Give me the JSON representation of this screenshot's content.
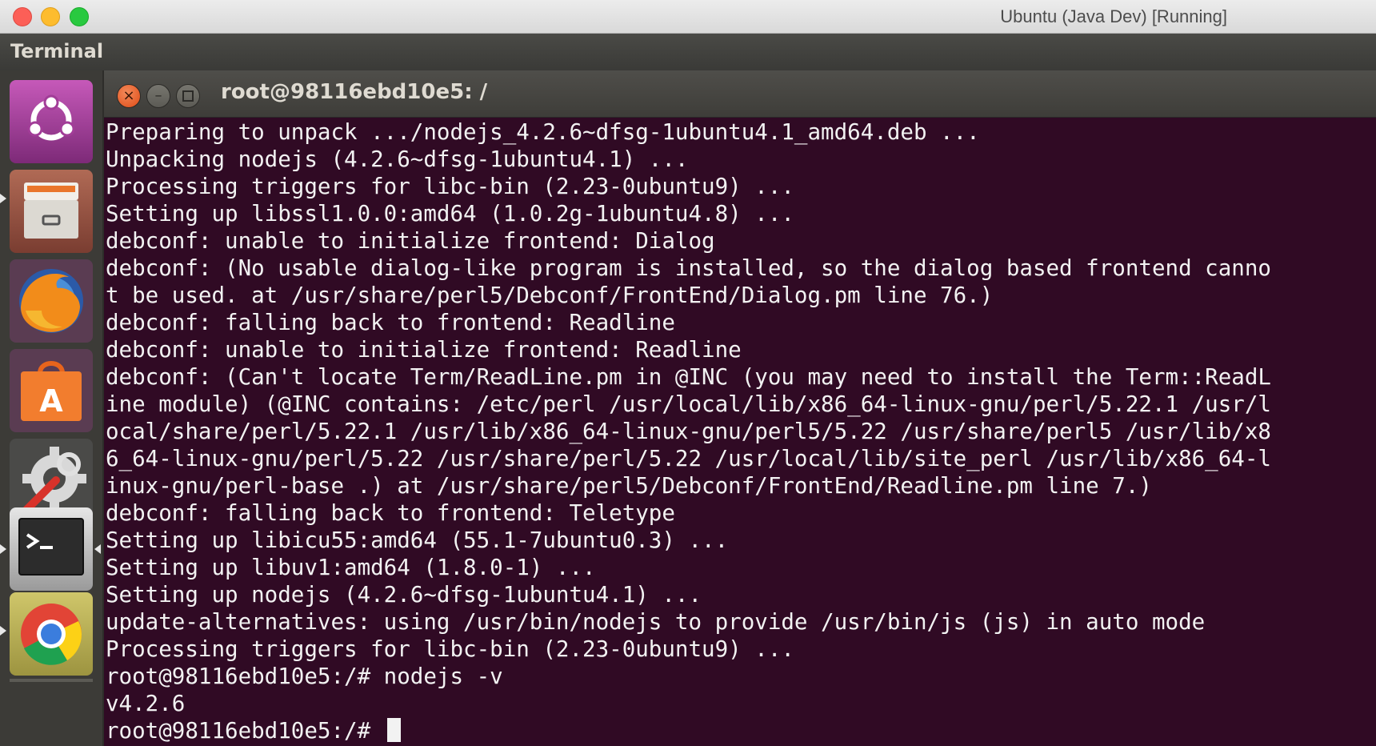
{
  "host_window": {
    "title": "Ubuntu (Java Dev) [Running]"
  },
  "panel": {
    "app_title": "Terminal"
  },
  "launcher": {
    "items": [
      {
        "name": "ubuntu-dash",
        "icon": "ubuntu-logo-icon"
      },
      {
        "name": "files",
        "icon": "file-cabinet-icon"
      },
      {
        "name": "firefox",
        "icon": "firefox-icon"
      },
      {
        "name": "software-center",
        "icon": "shopping-bag-icon"
      },
      {
        "name": "system-settings",
        "icon": "wrench-gear-icon"
      },
      {
        "name": "terminal",
        "icon": "terminal-icon"
      },
      {
        "name": "chrome",
        "icon": "chrome-icon"
      }
    ]
  },
  "terminal": {
    "title": "root@98116ebd10e5: /",
    "prompt": "root@98116ebd10e5:/# ",
    "colors": {
      "background": "#300a24",
      "foreground": "#f2f2f2",
      "close_button": "#df4b16"
    },
    "lines": [
      "Preparing to unpack .../nodejs_4.2.6~dfsg-1ubuntu4.1_amd64.deb ...",
      "Unpacking nodejs (4.2.6~dfsg-1ubuntu4.1) ...",
      "Processing triggers for libc-bin (2.23-0ubuntu9) ...",
      "Setting up libssl1.0.0:amd64 (1.0.2g-1ubuntu4.8) ...",
      "debconf: unable to initialize frontend: Dialog",
      "debconf: (No usable dialog-like program is installed, so the dialog based frontend canno",
      "t be used. at /usr/share/perl5/Debconf/FrontEnd/Dialog.pm line 76.)",
      "debconf: falling back to frontend: Readline",
      "debconf: unable to initialize frontend: Readline",
      "debconf: (Can't locate Term/ReadLine.pm in @INC (you may need to install the Term::ReadL",
      "ine module) (@INC contains: /etc/perl /usr/local/lib/x86_64-linux-gnu/perl/5.22.1 /usr/l",
      "ocal/share/perl/5.22.1 /usr/lib/x86_64-linux-gnu/perl5/5.22 /usr/share/perl5 /usr/lib/x8",
      "6_64-linux-gnu/perl/5.22 /usr/share/perl/5.22 /usr/local/lib/site_perl /usr/lib/x86_64-l",
      "inux-gnu/perl-base .) at /usr/share/perl5/Debconf/FrontEnd/Readline.pm line 7.)",
      "debconf: falling back to frontend: Teletype",
      "Setting up libicu55:amd64 (55.1-7ubuntu0.3) ...",
      "Setting up libuv1:amd64 (1.8.0-1) ...",
      "Setting up nodejs (4.2.6~dfsg-1ubuntu4.1) ...",
      "update-alternatives: using /usr/bin/nodejs to provide /usr/bin/js (js) in auto mode",
      "Processing triggers for libc-bin (2.23-0ubuntu9) ...",
      "root@98116ebd10e5:/# nodejs -v",
      "v4.2.6"
    ]
  }
}
